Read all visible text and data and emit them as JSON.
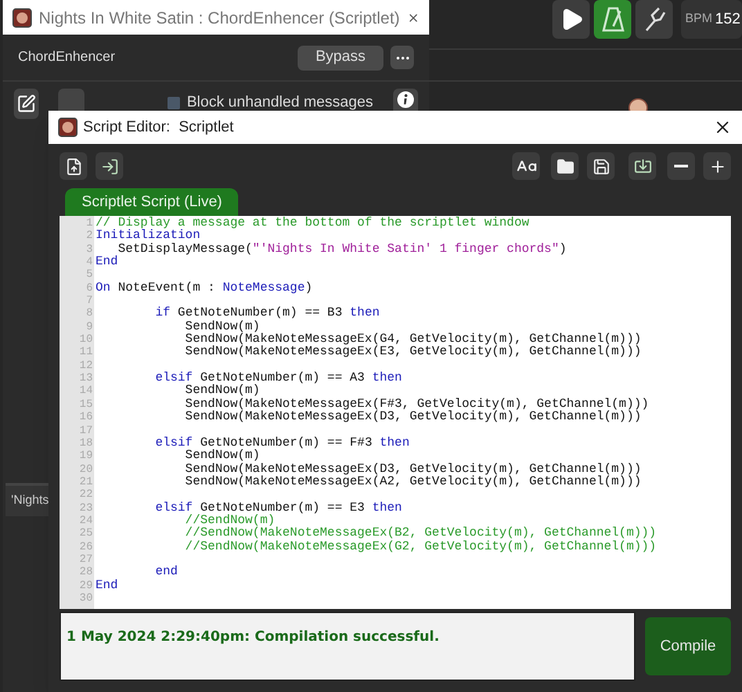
{
  "toolbar": {
    "buttons": [
      {
        "kind": "play",
        "selected": false
      },
      {
        "kind": "metronome",
        "selected": true
      },
      {
        "kind": "tuning-fork",
        "selected": false
      }
    ],
    "bpm_label": "BPM",
    "bpm_value": "152"
  },
  "plugin_window": {
    "title": "Nights In White Satin : ChordEnhencer (Scriptlet)",
    "name": "ChordEnhencer",
    "bypass_button": "Bypass",
    "block_unhandled": {
      "label": "Block unhandled messages",
      "checked": false
    },
    "side_tab": "'Nights"
  },
  "script_editor": {
    "title": "Script Editor:  Scriptlet",
    "tab": {
      "label": "Scriptlet Script (Live)",
      "selected": true
    },
    "lines": [
      {
        "number": "1",
        "segments": [
          {
            "kind": "comment",
            "text": "// Display a message at the bottom of the scriptlet window"
          }
        ]
      },
      {
        "number": "2",
        "segments": [
          {
            "kind": "keyword",
            "text": "Initialization"
          }
        ]
      },
      {
        "number": "3",
        "segments": [
          {
            "kind": "plain",
            "text": "   SetDisplayMessage("
          },
          {
            "kind": "string",
            "text": "\"'Nights In White Satin' 1 finger chords\""
          },
          {
            "kind": "plain",
            "text": ")"
          }
        ]
      },
      {
        "number": "4",
        "segments": [
          {
            "kind": "keyword",
            "text": "End"
          }
        ]
      },
      {
        "number": "5"
      },
      {
        "number": "6",
        "segments": [
          {
            "kind": "keyword",
            "text": "On"
          },
          {
            "kind": "plain",
            "text": " NoteEvent(m : "
          },
          {
            "kind": "keyword",
            "text": "NoteMessage"
          },
          {
            "kind": "plain",
            "text": ")"
          }
        ]
      },
      {
        "number": "7"
      },
      {
        "number": "8",
        "segments": [
          {
            "kind": "keyword",
            "text": "        if"
          },
          {
            "kind": "plain",
            "text": " GetNoteNumber(m) == B3 "
          },
          {
            "kind": "keyword",
            "text": "then"
          }
        ]
      },
      {
        "number": "9",
        "segments": [
          {
            "kind": "plain",
            "text": "            SendNow(m)"
          }
        ]
      },
      {
        "number": "10",
        "segments": [
          {
            "kind": "plain",
            "text": "            SendNow(MakeNoteMessageEx(G4, GetVelocity(m), GetChannel(m)))"
          }
        ]
      },
      {
        "number": "11",
        "segments": [
          {
            "kind": "plain",
            "text": "            SendNow(MakeNoteMessageEx(E3, GetVelocity(m), GetChannel(m)))"
          }
        ]
      },
      {
        "number": "12"
      },
      {
        "number": "13",
        "segments": [
          {
            "kind": "keyword",
            "text": "        elsif"
          },
          {
            "kind": "plain",
            "text": " GetNoteNumber(m) == A3 "
          },
          {
            "kind": "keyword",
            "text": "then"
          }
        ]
      },
      {
        "number": "14",
        "segments": [
          {
            "kind": "plain",
            "text": "            SendNow(m)"
          }
        ]
      },
      {
        "number": "15",
        "segments": [
          {
            "kind": "plain",
            "text": "            SendNow(MakeNoteMessageEx(F#3, GetVelocity(m), GetChannel(m)))"
          }
        ]
      },
      {
        "number": "16",
        "segments": [
          {
            "kind": "plain",
            "text": "            SendNow(MakeNoteMessageEx(D3, GetVelocity(m), GetChannel(m)))"
          }
        ]
      },
      {
        "number": "17"
      },
      {
        "number": "18",
        "segments": [
          {
            "kind": "keyword",
            "text": "        elsif"
          },
          {
            "kind": "plain",
            "text": " GetNoteNumber(m) == F#3 "
          },
          {
            "kind": "keyword",
            "text": "then"
          }
        ]
      },
      {
        "number": "19",
        "segments": [
          {
            "kind": "plain",
            "text": "            SendNow(m)"
          }
        ]
      },
      {
        "number": "20",
        "segments": [
          {
            "kind": "plain",
            "text": "            SendNow(MakeNoteMessageEx(D3, GetVelocity(m), GetChannel(m)))"
          }
        ]
      },
      {
        "number": "21",
        "segments": [
          {
            "kind": "plain",
            "text": "            SendNow(MakeNoteMessageEx(A2, GetVelocity(m), GetChannel(m)))"
          }
        ]
      },
      {
        "number": "22"
      },
      {
        "number": "23",
        "segments": [
          {
            "kind": "keyword",
            "text": "        elsif"
          },
          {
            "kind": "plain",
            "text": " GetNoteNumber(m) == E3 "
          },
          {
            "kind": "keyword",
            "text": "then"
          }
        ]
      },
      {
        "number": "24",
        "segments": [
          {
            "kind": "comment",
            "text": "            //SendNow(m)"
          }
        ]
      },
      {
        "number": "25",
        "segments": [
          {
            "kind": "comment",
            "text": "            //SendNow(MakeNoteMessageEx(B2, GetVelocity(m), GetChannel(m)))"
          }
        ]
      },
      {
        "number": "26",
        "segments": [
          {
            "kind": "comment",
            "text": "            //SendNow(MakeNoteMessageEx(G2, GetVelocity(m), GetChannel(m)))"
          }
        ]
      },
      {
        "number": "27"
      },
      {
        "number": "28",
        "segments": [
          {
            "kind": "keyword",
            "text": "        end"
          }
        ]
      },
      {
        "number": "29",
        "segments": [
          {
            "kind": "keyword",
            "text": "End"
          }
        ]
      },
      {
        "number": "30"
      }
    ],
    "status": "1 May 2024 2:29:40pm: Compilation successful.",
    "compile_button": "Compile"
  }
}
